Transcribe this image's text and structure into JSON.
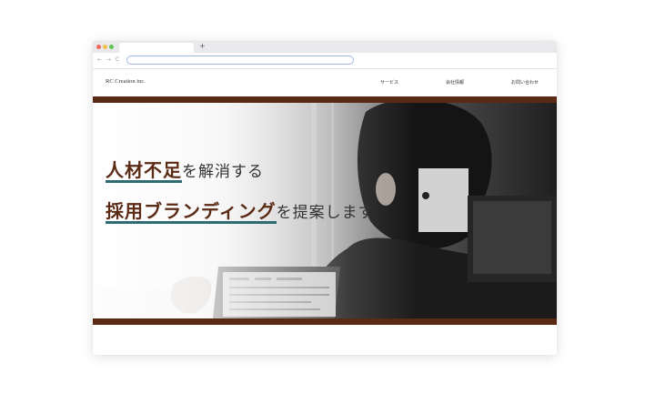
{
  "browser": {
    "new_tab_label": "+",
    "back_icon": "back-arrow-icon",
    "forward_icon": "forward-arrow-icon",
    "reload_icon": "reload-icon",
    "back_glyph": "←",
    "forward_glyph": "→",
    "reload_glyph": "C",
    "address": ""
  },
  "site": {
    "logo": "RC Creation inc.",
    "nav": [
      "サービス",
      "会社情報",
      "お問い合わせ"
    ]
  },
  "hero": {
    "line1_highlight": "人材不足",
    "line1_rest": "を解消する",
    "line2_highlight": "採用ブランディング",
    "line2_rest": "を提案します"
  },
  "colors": {
    "brand_brown": "#5b2a14",
    "underline_teal": "#2f6b73"
  }
}
